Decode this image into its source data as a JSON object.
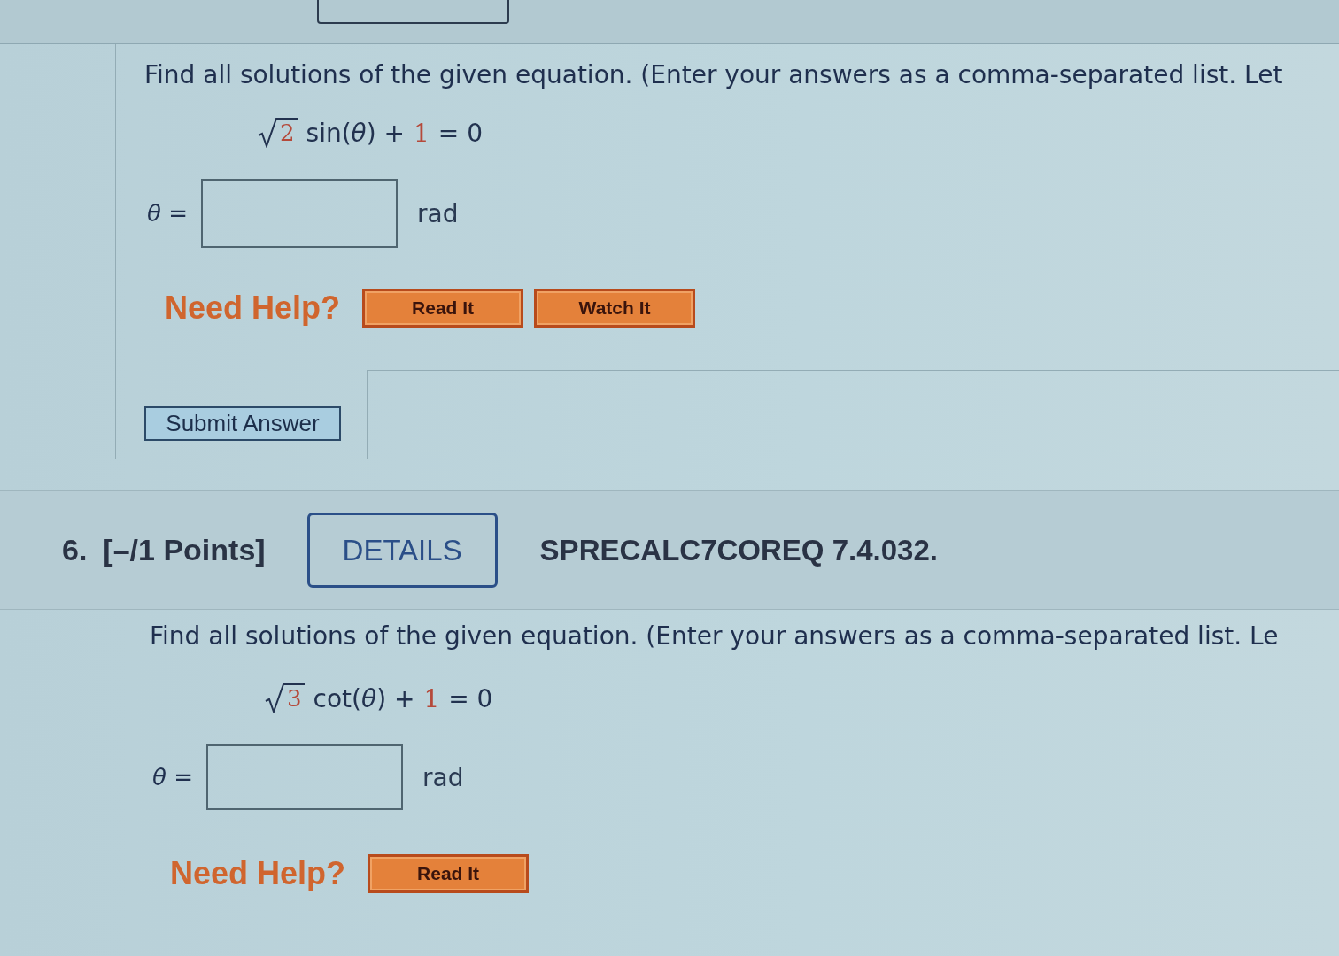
{
  "problems": [
    {
      "question": "Find all solutions of the given equation. (Enter your answers as a comma-separated list. Let",
      "equation": {
        "radicand": "2",
        "expression": "sin(*θ*) +",
        "constant": "1",
        "rhs": "= 0"
      },
      "answer": {
        "label": "*θ* =",
        "unit": "rad"
      },
      "help": {
        "label": "Need Help?",
        "buttons": [
          "Read It",
          "Watch It"
        ]
      },
      "submit": "Submit Answer"
    },
    {
      "number": "6.",
      "points": "[–/1 Points]",
      "details": "DETAILS",
      "code": "SPRECALC7COREQ 7.4.032.",
      "question": "Find all solutions of the given equation. (Enter your answers as a comma-separated list. Le",
      "equation": {
        "radicand": "3",
        "expression": "cot(*θ*) +",
        "constant": "1",
        "rhs": "= 0"
      },
      "answer": {
        "label": "*θ* =",
        "unit": "rad"
      },
      "help": {
        "label": "Need Help?",
        "buttons": [
          "Read It"
        ]
      }
    }
  ]
}
